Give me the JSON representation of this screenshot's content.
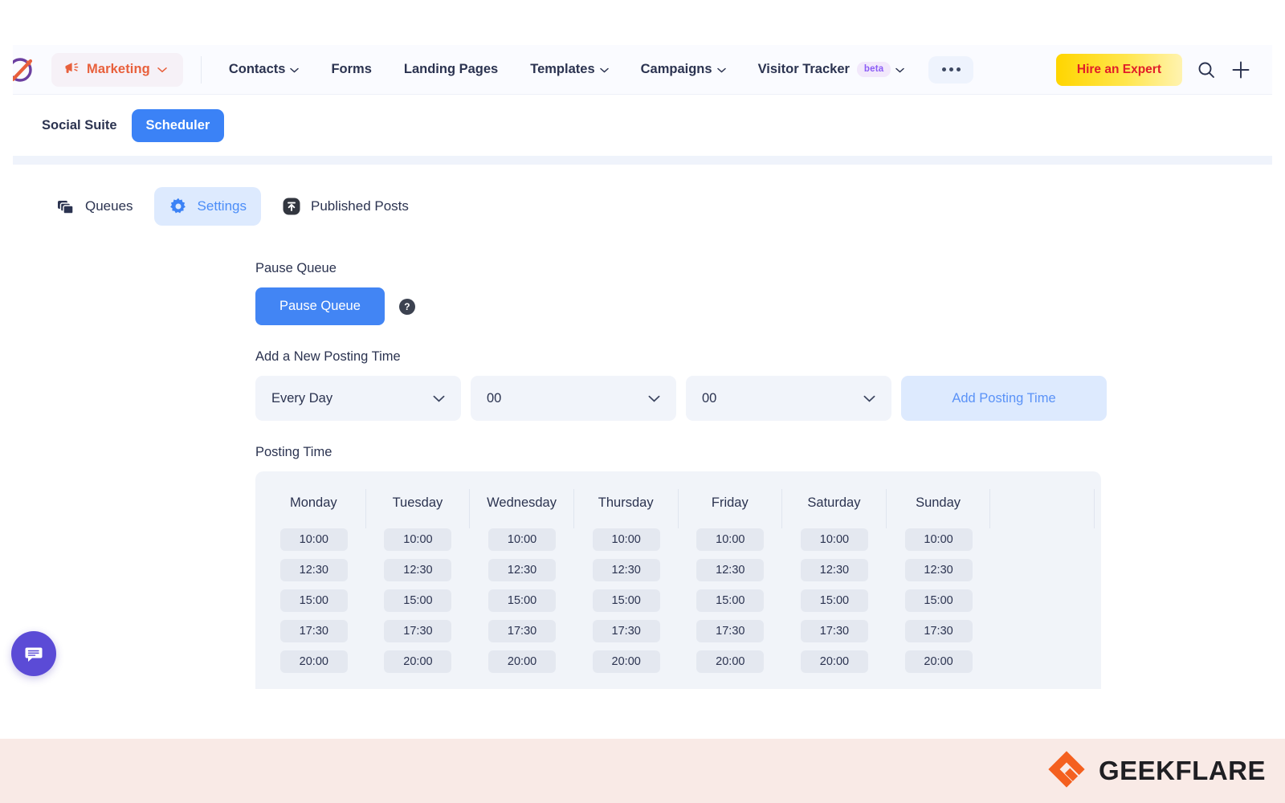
{
  "topnav": {
    "logo_icon": "zoho-marketing-logo-icon",
    "product": {
      "label": "Marketing",
      "icon": "megaphone-icon",
      "chevron": "chevron-down-icon"
    },
    "links": [
      {
        "label": "Contacts",
        "has_chevron": true
      },
      {
        "label": "Forms",
        "has_chevron": false
      },
      {
        "label": "Landing Pages",
        "has_chevron": false
      },
      {
        "label": "Templates",
        "has_chevron": true
      },
      {
        "label": "Campaigns",
        "has_chevron": true
      },
      {
        "label": "Visitor Tracker",
        "has_chevron": true,
        "badge": "beta"
      }
    ],
    "more_label": "more-menu",
    "hire_button": "Hire an Expert",
    "search_icon": "search-icon",
    "add_icon": "plus-icon",
    "accent_red": "#e11d28",
    "accent_yellow": "#ffd500"
  },
  "subnav": {
    "items": [
      {
        "label": "Social Suite",
        "active": false
      },
      {
        "label": "Scheduler",
        "active": true
      }
    ],
    "active_color": "#3b82f6"
  },
  "tabs": [
    {
      "label": "Queues",
      "icon": "layers-icon",
      "active": false
    },
    {
      "label": "Settings",
      "icon": "gear-icon",
      "active": true
    },
    {
      "label": "Published Posts",
      "icon": "upload-arrow-icon",
      "active": false
    }
  ],
  "settings": {
    "pause_queue": {
      "label": "Pause Queue",
      "button_label": "Pause Queue",
      "help_icon": "question-mark-icon"
    },
    "add_posting_time": {
      "label": "Add a New Posting Time",
      "day_value": "Every Day",
      "hour_value": "00",
      "minute_value": "00",
      "add_button_label": "Add Posting Time"
    },
    "posting_time": {
      "label": "Posting Time",
      "days": [
        "Monday",
        "Tuesday",
        "Wednesday",
        "Thursday",
        "Friday",
        "Saturday",
        "Sunday"
      ],
      "times": {
        "Monday": [
          "10:00",
          "12:30",
          "15:00",
          "17:30",
          "20:00"
        ],
        "Tuesday": [
          "10:00",
          "12:30",
          "15:00",
          "17:30",
          "20:00"
        ],
        "Wednesday": [
          "10:00",
          "12:30",
          "15:00",
          "17:30",
          "20:00"
        ],
        "Thursday": [
          "10:00",
          "12:30",
          "15:00",
          "17:30",
          "20:00"
        ],
        "Friday": [
          "10:00",
          "12:30",
          "15:00",
          "17:30",
          "20:00"
        ],
        "Saturday": [
          "10:00",
          "12:30",
          "15:00",
          "17:30",
          "20:00"
        ],
        "Sunday": [
          "10:00",
          "12:30",
          "15:00",
          "17:30",
          "20:00"
        ]
      }
    }
  },
  "chat_widget": {
    "icon": "chat-bubble-icon",
    "color": "#5b4bd6"
  },
  "footer": {
    "brand": "GEEKFLARE",
    "mark_color": "#f4601f"
  }
}
